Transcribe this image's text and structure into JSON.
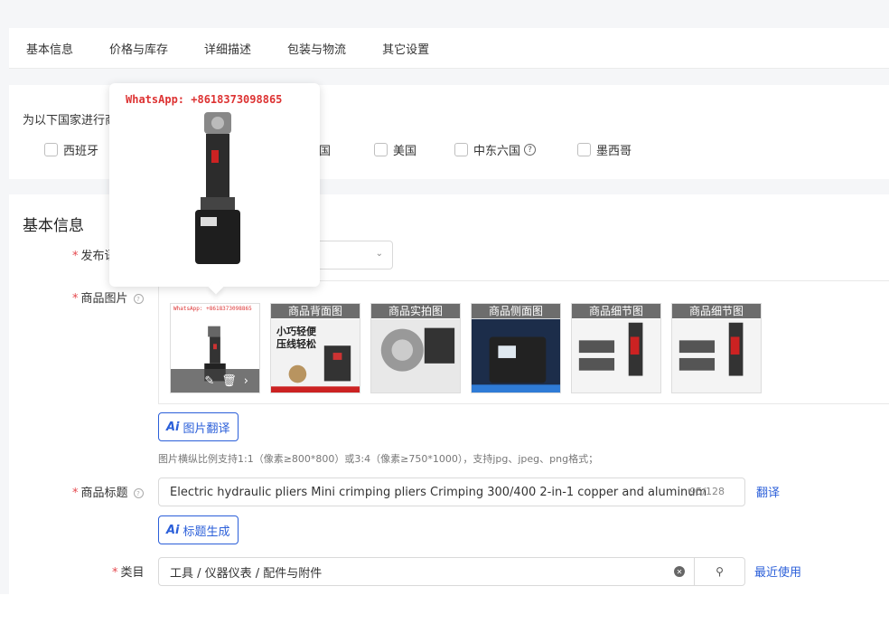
{
  "tabs": [
    "基本信息",
    "价格与库存",
    "详细描述",
    "包装与物流",
    "其它设置"
  ],
  "country": {
    "title": "为以下国家进行商品信息差异化设置:",
    "options": [
      {
        "label": "西班牙",
        "help": false
      },
      {
        "label": "韩国",
        "help": false
      },
      {
        "label": "美国",
        "help": false
      },
      {
        "label": "中东六国",
        "help": true
      },
      {
        "label": "墨西哥",
        "help": false
      }
    ]
  },
  "basic": {
    "section_title": "基本信息",
    "publish_label": "发布语",
    "images_label": "商品图片",
    "thumbs": [
      {
        "label": "",
        "watermark": "WhatsApp: +8618373098865"
      },
      {
        "label": "商品背面图",
        "caption": "小巧轻便 压线轻松"
      },
      {
        "label": "商品实拍图"
      },
      {
        "label": "商品侧面图"
      },
      {
        "label": "商品细节图"
      },
      {
        "label": "商品细节图"
      }
    ],
    "img_translate_btn": "图片翻译",
    "hint": "图片横纵比例支持1:1（像素≥800*800）或3:4（像素≥750*1000），支持jpg、jpeg、png格式；",
    "title_label": "商品标题",
    "title_value": "Electric hydraulic pliers Mini crimping pliers Crimping 300/400 2-in-1 copper and aluminum",
    "title_counter": "95/128",
    "translate_link": "翻译",
    "title_gen_btn": "标题生成",
    "category_label": "类目",
    "category_value": "工具 / 仪器仪表 / 配件与附件",
    "recent_link": "最近使用"
  },
  "popover": {
    "watermark": "WhatsApp: +8618373098865"
  },
  "colors": {
    "accent": "#2b5fd9",
    "required": "#e5484d"
  }
}
